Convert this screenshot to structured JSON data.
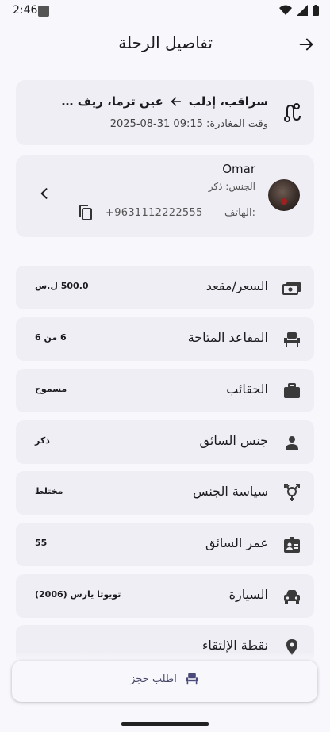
{
  "status_bar": {
    "time": "2:46"
  },
  "app_bar": {
    "title": "تفاصيل الرحلة"
  },
  "trip": {
    "from": "سراقب، إدلب",
    "to": "عين ترما، ريف دمشق",
    "departure_label": "وقت المغادرة:",
    "departure_value": "2025-08-31 09:15"
  },
  "driver": {
    "name": "Omar",
    "gender_label": "الجنس:",
    "gender_value": "ذكر",
    "phone_label": "الهاتف:",
    "phone_value": "+9631112222555"
  },
  "details": [
    {
      "label": "السعر/مقعد",
      "value": "500.0 ل.س",
      "icon": "cash-icon"
    },
    {
      "label": "المقاعد المتاحة",
      "value": "6 من 6",
      "icon": "seat-icon"
    },
    {
      "label": "الحقائب",
      "value": "مسموح",
      "icon": "luggage-icon"
    },
    {
      "label": "جنس السائق",
      "value": "ذكر",
      "icon": "person-icon"
    },
    {
      "label": "سياسة الجنس",
      "value": "مختلط",
      "icon": "gender-icon"
    },
    {
      "label": "عمر السائق",
      "value": "55",
      "icon": "id-badge-icon"
    },
    {
      "label": "السيارة",
      "value": "تويوتا يارس (2006)",
      "icon": "car-icon"
    },
    {
      "label": "نقطة الإلتقاء",
      "value": "",
      "icon": "location-pin-icon"
    }
  ],
  "booking": {
    "label": "اطلب حجز"
  },
  "colors": {
    "background": "#f8f7fc",
    "card": "#efeef4",
    "text": "#1c1b1f"
  }
}
